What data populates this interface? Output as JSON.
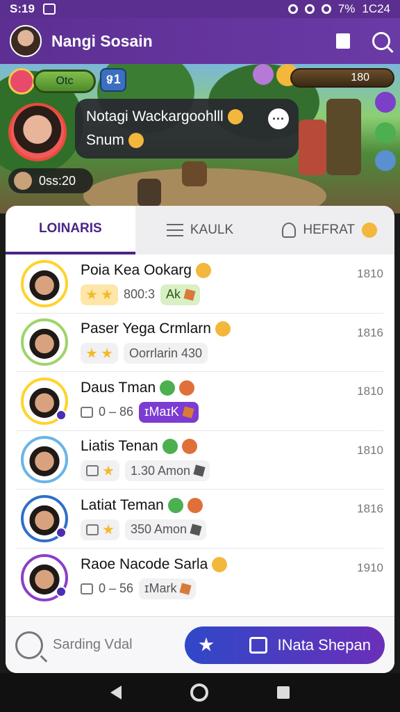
{
  "status": {
    "time": "S:19",
    "battery": "7%",
    "clock": "1C24"
  },
  "header": {
    "title": "Nangi Sosain"
  },
  "game": {
    "hud_left_label": "Otc",
    "hud_badge": "ទ1",
    "coins": "180",
    "chat_line1": "Notagi Wackargoohlll",
    "chat_line2": "Snum",
    "timer": "0ss:20"
  },
  "tabs": [
    {
      "label": "LOINARIS",
      "icon": ""
    },
    {
      "label": "KAULK",
      "icon": "list-icon"
    },
    {
      "label": "HEFRAT",
      "icon": "person-icon"
    }
  ],
  "rows": [
    {
      "name": "Poia Kea Ookarg",
      "score": "1810",
      "meta_text": "800:3",
      "chip_label": "Ak",
      "chip_style": "green",
      "border": "#ffd32a"
    },
    {
      "name": "Paser Yega Crmlarn",
      "score": "1816",
      "meta_text": "Oorrlarin 430",
      "chip_label": "",
      "chip_style": "",
      "border": "#9fd36a"
    },
    {
      "name": "Daus Tman",
      "score": "1810",
      "meta_text": "0 – 86",
      "chip_label": "ɪMaɪK",
      "chip_style": "purple",
      "border": "#ffd32a"
    },
    {
      "name": "Liatis Tenan",
      "score": "1810",
      "meta_text": "1.30 Amon",
      "chip_label": "",
      "chip_style": "",
      "border": "#6ab4e8"
    },
    {
      "name": "Latiat Teman",
      "score": "1816",
      "meta_text": "350 Amon",
      "chip_label": "",
      "chip_style": "",
      "border": "#2f6fc8"
    },
    {
      "name": "Raoe Nacode Sarla",
      "score": "1910",
      "meta_text": "0 – 56",
      "chip_label": "ɪMark",
      "chip_style": "",
      "border": "#8a3fc8"
    }
  ],
  "bottom": {
    "sort_label": "Sarding Vdal",
    "cta_label": "INata Shepan"
  }
}
